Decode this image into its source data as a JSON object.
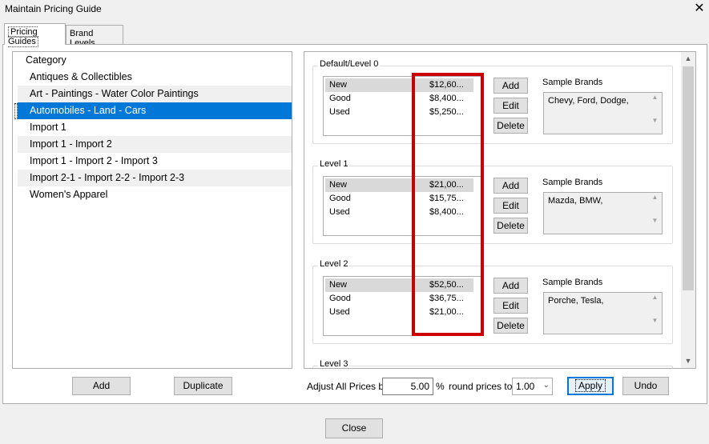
{
  "window": {
    "title": "Maintain Pricing Guide",
    "close_label": "✕"
  },
  "tabs": [
    {
      "label": "Pricing Guides"
    },
    {
      "label": "Brand Levels"
    }
  ],
  "categories": {
    "header": "Category",
    "items": [
      "Antiques & Collectibles",
      "Art - Paintings - Water Color Paintings",
      "Automobiles - Land - Cars",
      "Import 1",
      "Import 1 - Import 2",
      "Import 1 - Import 2 - Import 3",
      "Import 2-1 - Import 2-2 - Import 2-3",
      "Women's Apparel"
    ],
    "selected": "Automobiles - Land - Cars"
  },
  "levels": [
    {
      "label": "Default/Level 0",
      "rows": [
        {
          "condition": "New",
          "price": "$12,60..."
        },
        {
          "condition": "Good",
          "price": "$8,400..."
        },
        {
          "condition": "Used",
          "price": "$5,250..."
        }
      ],
      "brands_label": "Sample Brands",
      "brands": "Chevy, Ford, Dodge,"
    },
    {
      "label": "Level 1",
      "rows": [
        {
          "condition": "New",
          "price": "$21,00..."
        },
        {
          "condition": "Good",
          "price": "$15,75..."
        },
        {
          "condition": "Used",
          "price": "$8,400..."
        }
      ],
      "brands_label": "Sample Brands",
      "brands": "Mazda, BMW,"
    },
    {
      "label": "Level 2",
      "rows": [
        {
          "condition": "New",
          "price": "$52,50..."
        },
        {
          "condition": "Good",
          "price": "$36,75..."
        },
        {
          "condition": "Used",
          "price": "$21,00..."
        }
      ],
      "brands_label": "Sample Brands",
      "brands": "Porche, Tesla,"
    },
    {
      "label": "Level 3"
    }
  ],
  "group_buttons": {
    "add": "Add",
    "edit": "Edit",
    "delete": "Delete"
  },
  "bottom": {
    "add": "Add",
    "duplicate": "Duplicate",
    "adjust_label": "Adjust All Prices by",
    "adjust_value": "5.00",
    "percent": "%",
    "round_label": "round prices to",
    "round_value": "1.00",
    "apply": "Apply",
    "undo": "Undo",
    "close": "Close"
  },
  "colors": {
    "selection": "#0078d7",
    "highlight_box": "#cc0000"
  }
}
